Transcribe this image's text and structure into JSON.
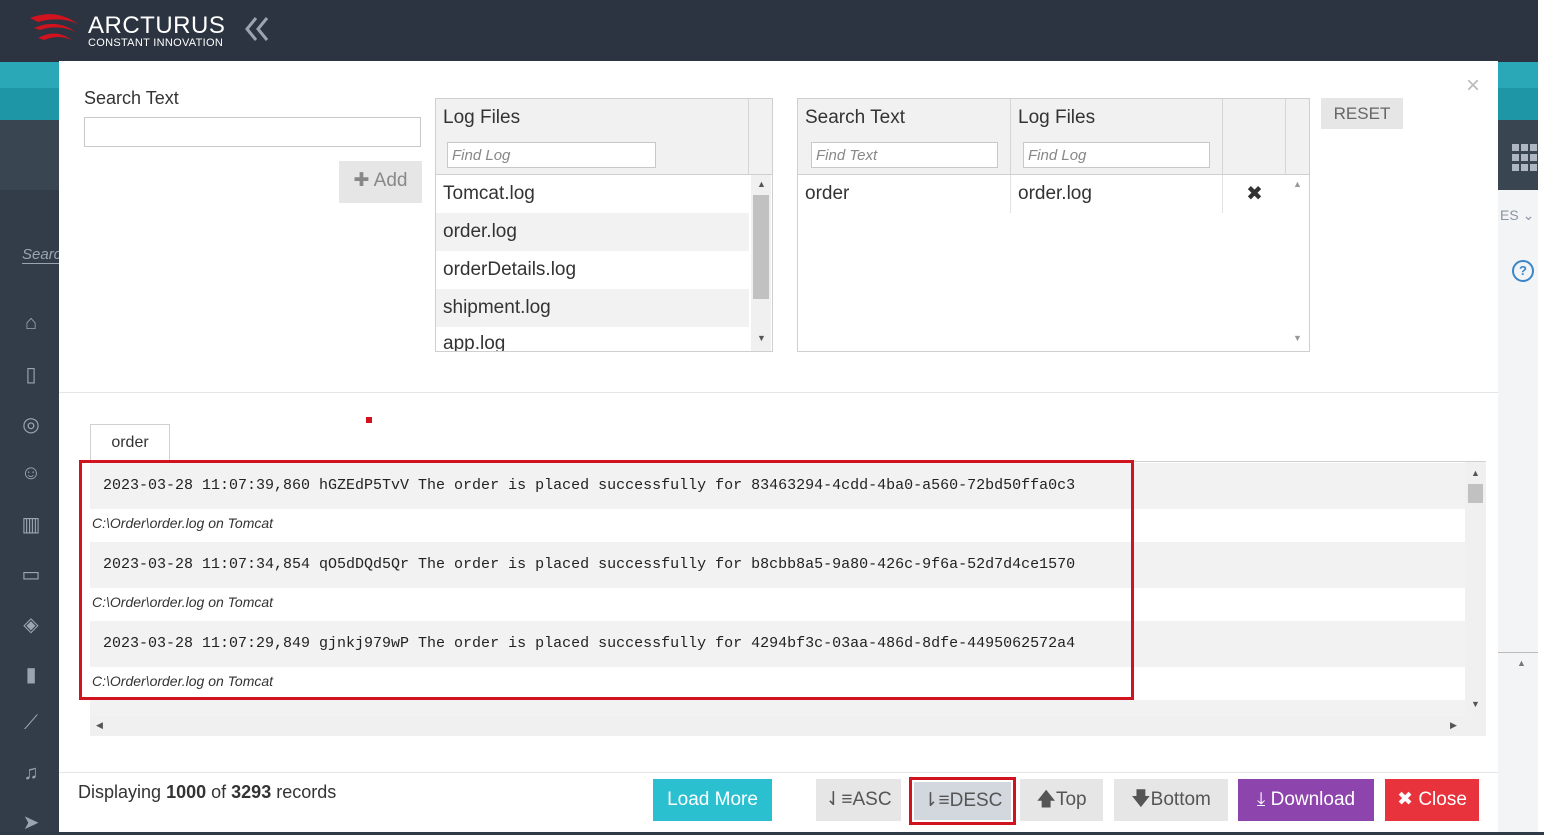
{
  "app": {
    "logo_name": "ARCTURUS",
    "logo_tagline": "CONSTANT INNOVATION",
    "collapse_icon": "double-chevron-left-icon"
  },
  "background": {
    "search_placeholder": "Searc",
    "header_fragment": "ES"
  },
  "modal": {
    "close_glyph": "×",
    "search_text_label": "Search Text",
    "search_text_value": "",
    "add_label": "Add",
    "log_files": {
      "header": "Log Files",
      "filter_placeholder": "Find Log",
      "items": [
        "Tomcat.log",
        "order.log",
        "orderDetails.log",
        "shipment.log",
        "app.log"
      ]
    },
    "selection": {
      "col_search_text": "Search Text",
      "col_log_files": "Log Files",
      "search_filter_placeholder": "Find Text",
      "log_filter_placeholder": "Find Log",
      "rows": [
        {
          "search_text": "order",
          "log_file": "order.log",
          "remove_glyph": "✖"
        }
      ]
    },
    "reset_label": "RESET",
    "tab_label": "order",
    "logs": [
      {
        "line": "2023-03-28 11:07:39,860 hGZEdP5TvV The order is placed successfully for 83463294-4cdd-4ba0-a560-72bd50ffa0c3",
        "path": "C:\\Order\\order.log on Tomcat"
      },
      {
        "line": "2023-03-28 11:07:34,854 qO5dDQd5Qr The order is placed successfully for b8cbb8a5-9a80-426c-9f6a-52d7d4ce1570",
        "path": "C:\\Order\\order.log on Tomcat"
      },
      {
        "line": "2023-03-28 11:07:29,849 gjnkj979wP The order is placed successfully for 4294bf3c-03aa-486d-8dfe-4495062572a4",
        "path": "C:\\Order\\order.log on Tomcat"
      }
    ],
    "footer": {
      "display_prefix": "Displaying",
      "displayed": "1000",
      "of_word": "of",
      "total": "3293",
      "records_word": "records",
      "load_more": "Load More",
      "asc": "ASC",
      "desc": "DESC",
      "top": "Top",
      "bottom": "Bottom",
      "download": "Download",
      "close": "Close"
    }
  },
  "colors": {
    "teal": "#2aa8b8",
    "purple": "#8e44ad",
    "red": "#e8333c",
    "highlight": "#d0131f"
  }
}
